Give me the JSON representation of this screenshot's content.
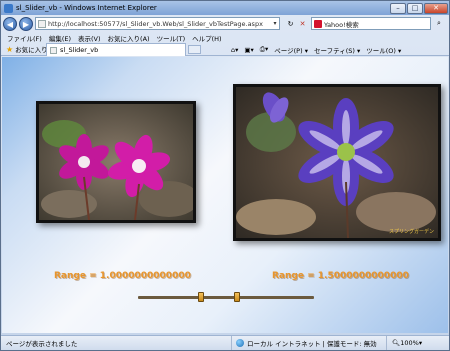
{
  "window": {
    "title": "sl_Slider_vb - Windows Internet Explorer"
  },
  "nav": {
    "url": "http://localhost:50577/sl_Slider_vb.Web/sl_Slider_vbTestPage.aspx",
    "search_label": "Yahoo!検索"
  },
  "menu": [
    "ファイル(F)",
    "編集(E)",
    "表示(V)",
    "お気に入り(A)",
    "ツール(T)",
    "ヘルプ(H)"
  ],
  "favorites": {
    "label": "お気に入り"
  },
  "tab": {
    "label": "sl_Slider_vb"
  },
  "tools": [
    "ページ(P) ▾",
    "セーフティ(S) ▾",
    "ツール(O) ▾"
  ],
  "content": {
    "range1_text": "Range = 1.0000000000000",
    "range2_text": "Range = 1.5000000000000",
    "slider": {
      "min": 0,
      "max": 1,
      "thumbs": [
        0.36,
        0.56
      ]
    },
    "photo2_caption": "スプリングガーデン"
  },
  "status": {
    "text": "ページが表示されました",
    "zone": "ローカル イントラネット | 保護モード: 無効",
    "zoom": "100%"
  },
  "colors": {
    "range_text": "#e8952c",
    "titlebar": "#7ea3d6"
  }
}
